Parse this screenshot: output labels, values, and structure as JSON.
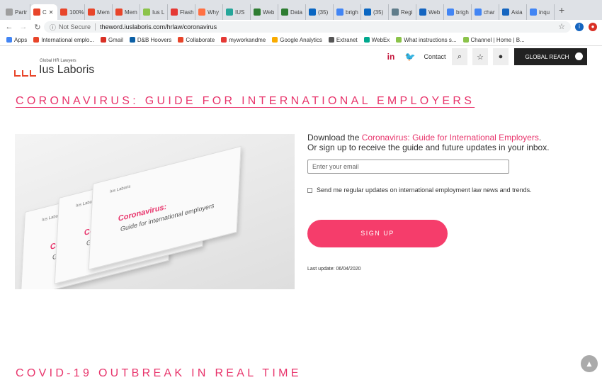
{
  "browser": {
    "tabs": [
      {
        "label": "Partr",
        "color": "#9e9e9e"
      },
      {
        "label": "C",
        "color": "#e8452a",
        "active": true
      },
      {
        "label": "100%",
        "color": "#e8452a"
      },
      {
        "label": "Mem",
        "color": "#e8452a"
      },
      {
        "label": "Mem",
        "color": "#e8452a"
      },
      {
        "label": "Ius L",
        "color": "#8bc34a"
      },
      {
        "label": "Flash",
        "color": "#e53935"
      },
      {
        "label": "Why",
        "color": "#ff7043"
      },
      {
        "label": "IUS",
        "color": "#26a69a"
      },
      {
        "label": "Web",
        "color": "#2e7d32"
      },
      {
        "label": "Data",
        "color": "#2e7d32"
      },
      {
        "label": "(35)",
        "color": "#0a66c2"
      },
      {
        "label": "brigh",
        "color": "#4285f4"
      },
      {
        "label": "(35)",
        "color": "#0a66c2"
      },
      {
        "label": "Regi",
        "color": "#607d8b"
      },
      {
        "label": "Web",
        "color": "#1565c0"
      },
      {
        "label": "brigh",
        "color": "#4285f4"
      },
      {
        "label": "char",
        "color": "#4285f4"
      },
      {
        "label": "Asia",
        "color": "#1565c0"
      },
      {
        "label": "inqu",
        "color": "#4285f4"
      }
    ],
    "close_glyph": "✕",
    "new_tab_glyph": "+",
    "security_text": "Not Secure",
    "url": "theword.iuslaboris.com/hrlaw/coronavirus",
    "profile_initial": "i",
    "bookmarks": [
      {
        "label": "Apps",
        "color": "#4285f4"
      },
      {
        "label": "International emplo...",
        "color": "#e8452a"
      },
      {
        "label": "Gmail",
        "color": "#d93025"
      },
      {
        "label": "D&B Hoovers",
        "color": "#0b5fa5"
      },
      {
        "label": "Collaborate",
        "color": "#e8452a"
      },
      {
        "label": "myworkandme",
        "color": "#e53935"
      },
      {
        "label": "Google Analytics",
        "color": "#f9ab00"
      },
      {
        "label": "Extranet",
        "color": "#555555"
      },
      {
        "label": "WebEx",
        "color": "#00a88e"
      },
      {
        "label": "What instructions s...",
        "color": "#8bc34a"
      },
      {
        "label": "Channel | Home | B...",
        "color": "#8bc34a"
      }
    ]
  },
  "site": {
    "logo_sub": "Global HR Lawyers",
    "logo_name": "Ius Laboris",
    "linkedin": "in",
    "twitter": "t",
    "contact": "Contact",
    "global_reach": "GLOBAL REACH"
  },
  "main": {
    "title": "CORONAVIRUS: GUIDE FOR INTERNATIONAL EMPLOYERS",
    "download_prefix": "Download the ",
    "download_link": "Coronavirus: Guide for International Employers",
    "download_suffix": ".",
    "signup_line": "Or sign up to receive the guide and future updates in your inbox.",
    "email_placeholder": "Enter your email",
    "checkbox_label": "Send me regular updates on international employment law news and trends.",
    "signup_button": "SIGN UP",
    "last_update": "Last update: 06/04/2020",
    "section2_title": "COVID-19 OUTBREAK IN REAL TIME"
  },
  "hero_image": {
    "book_logo": "Ius Laboris",
    "book_title": "Coronavirus:",
    "book_subtitle": "Guide for international employers"
  },
  "colors": {
    "accent": "#e8356c",
    "button": "#f53d6b",
    "logo": "#e8452a"
  }
}
